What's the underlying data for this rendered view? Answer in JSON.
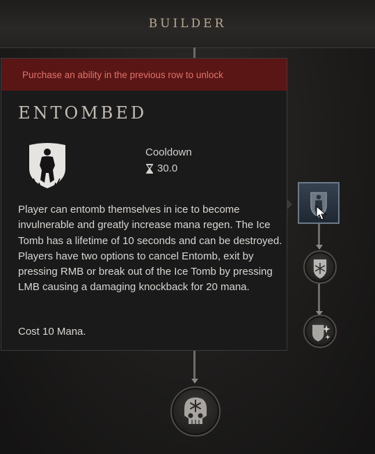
{
  "header": {
    "title": "BUILDER"
  },
  "tooltip": {
    "lock_message": "Purchase an ability in the previous row to unlock",
    "ability_name": "ENTOMBED",
    "cooldown_label": "Cooldown",
    "cooldown_value": "30.0",
    "description": "Player can entomb themselves in ice to become invulnerable and greatly increase mana regen. The Ice Tomb has a lifetime of 10 seconds and can be destroyed.  Players have two options to cancel Entomb, exit by pressing RMB or break out of the Ice Tomb by pressing LMB causing a damaging knockback for 20 mana.",
    "cost": "Cost 10 Mana."
  },
  "tree": {
    "nodes": [
      {
        "id": "entombed",
        "icon": "entombed-figure-icon",
        "state": "hovered"
      },
      {
        "id": "frost-shield",
        "icon": "snowflake-shield-icon",
        "state": "locked"
      },
      {
        "id": "sparkle-shield",
        "icon": "sparkle-shield-icon",
        "state": "locked"
      },
      {
        "id": "frost-skull",
        "icon": "snowflake-skull-icon",
        "state": "locked"
      }
    ]
  },
  "colors": {
    "banner_bg": "#5a1515",
    "banner_text": "#e0736a",
    "title_text": "#c3bcb3",
    "header_text": "#b9aa8e"
  }
}
